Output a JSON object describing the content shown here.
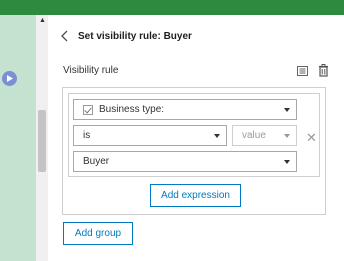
{
  "header": {
    "title": "Set visibility rule: Buyer"
  },
  "section": {
    "label": "Visibility rule"
  },
  "rule": {
    "field_select": {
      "value": "Business type:"
    },
    "operator_select": {
      "value": "is"
    },
    "type_select": {
      "value": "value"
    },
    "value_select": {
      "value": "Buyer"
    }
  },
  "buttons": {
    "add_expression": "Add expression",
    "add_group": "Add group"
  },
  "icons": {
    "back": "chevron-left-icon",
    "copy": "copy-icon",
    "delete": "trash-icon",
    "play": "play-icon",
    "remove": "close-icon",
    "checkbox": "checkbox-checked-icon",
    "scroll_up": "scroll-up-arrow-icon"
  },
  "colors": {
    "topbar": "#2e8a3e",
    "leftpane": "#c5e1cf",
    "accent": "#007ac2",
    "play": "#7b8fd4"
  }
}
